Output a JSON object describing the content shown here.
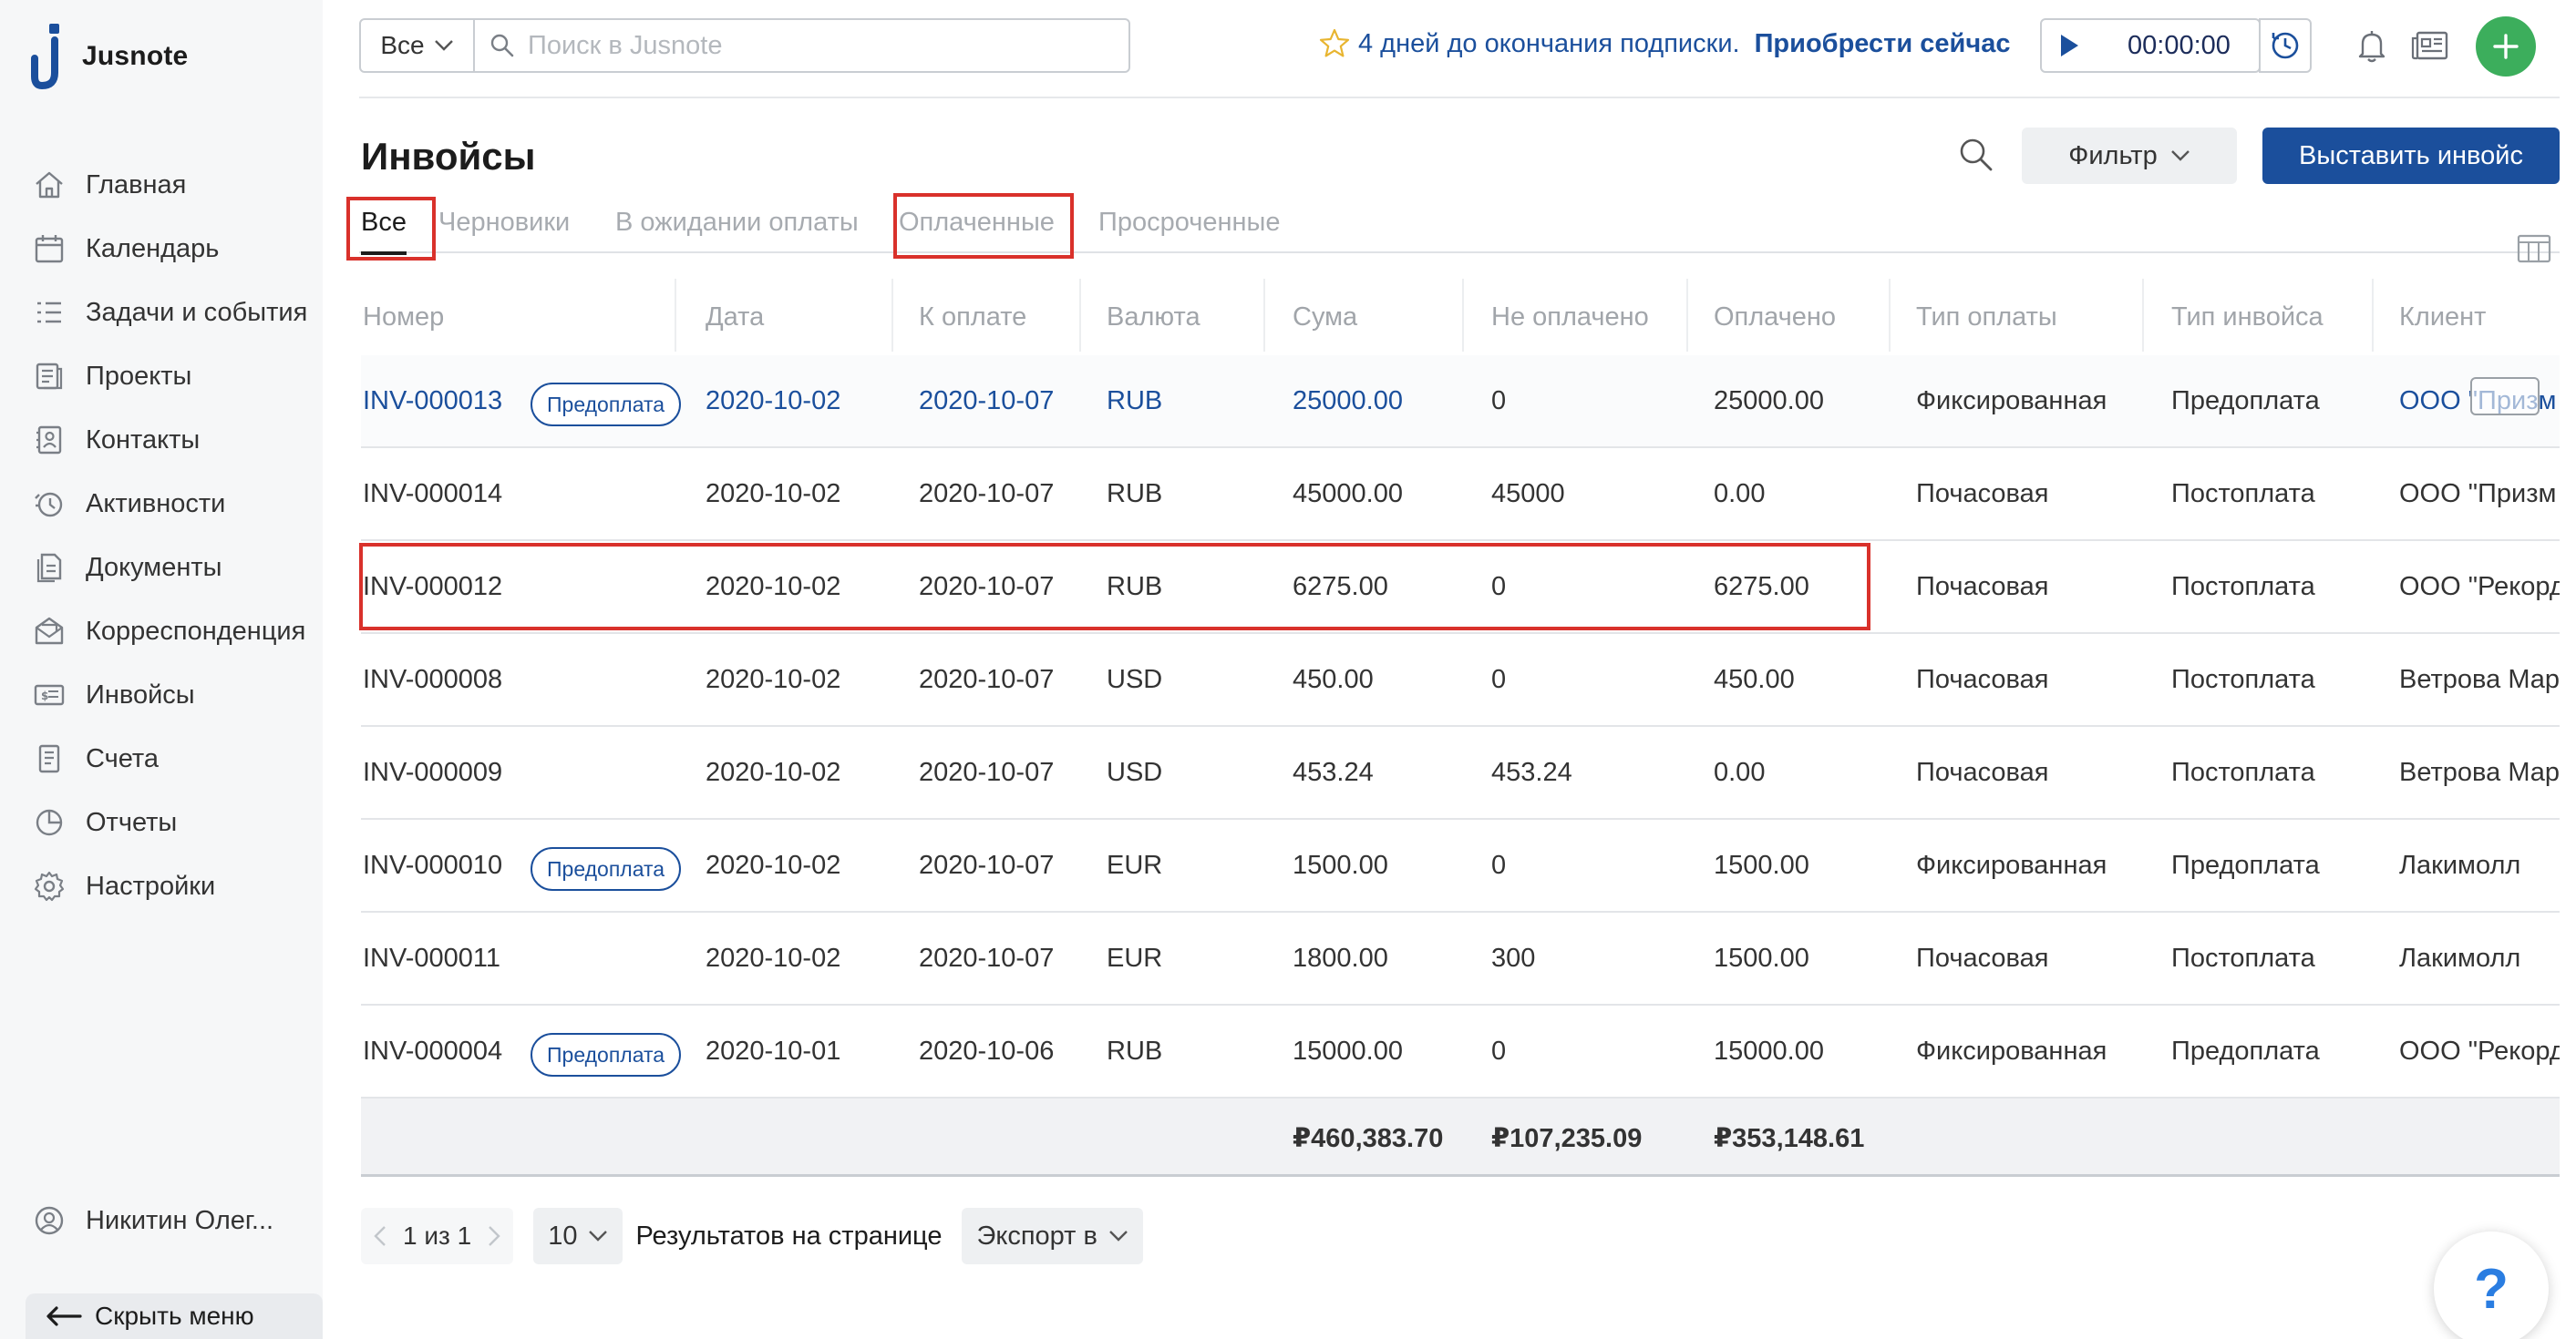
{
  "app": {
    "name": "Jusnote"
  },
  "sidebar": {
    "items": [
      {
        "label": "Главная",
        "icon": "home-icon"
      },
      {
        "label": "Календарь",
        "icon": "calendar-icon"
      },
      {
        "label": "Задачи и события",
        "icon": "tasks-icon"
      },
      {
        "label": "Проекты",
        "icon": "projects-icon"
      },
      {
        "label": "Контакты",
        "icon": "contacts-icon"
      },
      {
        "label": "Активности",
        "icon": "activity-icon"
      },
      {
        "label": "Документы",
        "icon": "documents-icon"
      },
      {
        "label": "Корреспонденция",
        "icon": "correspondence-icon"
      },
      {
        "label": "Инвойсы",
        "icon": "invoices-icon"
      },
      {
        "label": "Счета",
        "icon": "bills-icon"
      },
      {
        "label": "Отчеты",
        "icon": "reports-icon"
      },
      {
        "label": "Настройки",
        "icon": "settings-icon"
      }
    ],
    "user_name": "Никитин Олег...",
    "hide_menu_label": "Скрыть меню"
  },
  "topbar": {
    "scope_value": "Все",
    "search_placeholder": "Поиск в Jusnote",
    "subscription_text": "4 дней до окончания подписки.",
    "subscription_buy": "Приобрести сейчас",
    "timer_value": "00:00:00"
  },
  "page": {
    "title": "Инвойсы",
    "filter_label": "Фильтр",
    "issue_button": "Выставить инвойс"
  },
  "tabs": [
    {
      "label": "Все",
      "active": true
    },
    {
      "label": "Черновики",
      "active": false
    },
    {
      "label": "В ожидании оплаты",
      "active": false
    },
    {
      "label": "Оплаченные",
      "active": false
    },
    {
      "label": "Просроченные",
      "active": false
    }
  ],
  "table": {
    "columns": [
      "Номер",
      "Дата",
      "К оплате",
      "Валюта",
      "Сума",
      "Не оплачено",
      "Оплачено",
      "Тип оплаты",
      "Тип инвойса",
      "Клиент"
    ],
    "rows": [
      {
        "number": "INV-000013",
        "badge": "Предоплата",
        "date": "2020-10-02",
        "due": "2020-10-07",
        "currency": "RUB",
        "amount": "25000.00",
        "unpaid": "0",
        "paid": "25000.00",
        "pay_type": "Фиксированная",
        "invoice_type": "Предоплата",
        "client": "ООО \"Призм"
      },
      {
        "number": "INV-000014",
        "badge": "",
        "date": "2020-10-02",
        "due": "2020-10-07",
        "currency": "RUB",
        "amount": "45000.00",
        "unpaid": "45000",
        "paid": "0.00",
        "pay_type": "Почасовая",
        "invoice_type": "Постоплата",
        "client": "ООО \"Призм"
      },
      {
        "number": "INV-000012",
        "badge": "",
        "date": "2020-10-02",
        "due": "2020-10-07",
        "currency": "RUB",
        "amount": "6275.00",
        "unpaid": "0",
        "paid": "6275.00",
        "pay_type": "Почасовая",
        "invoice_type": "Постоплата",
        "client": "ООО \"Рекорд"
      },
      {
        "number": "INV-000008",
        "badge": "",
        "date": "2020-10-02",
        "due": "2020-10-07",
        "currency": "USD",
        "amount": "450.00",
        "unpaid": "0",
        "paid": "450.00",
        "pay_type": "Почасовая",
        "invoice_type": "Постоплата",
        "client": "Ветрова Мар"
      },
      {
        "number": "INV-000009",
        "badge": "",
        "date": "2020-10-02",
        "due": "2020-10-07",
        "currency": "USD",
        "amount": "453.24",
        "unpaid": "453.24",
        "paid": "0.00",
        "pay_type": "Почасовая",
        "invoice_type": "Постоплата",
        "client": "Ветрова Мар"
      },
      {
        "number": "INV-000010",
        "badge": "Предоплата",
        "date": "2020-10-02",
        "due": "2020-10-07",
        "currency": "EUR",
        "amount": "1500.00",
        "unpaid": "0",
        "paid": "1500.00",
        "pay_type": "Фиксированная",
        "invoice_type": "Предоплата",
        "client": "Лакимолл"
      },
      {
        "number": "INV-000011",
        "badge": "",
        "date": "2020-10-02",
        "due": "2020-10-07",
        "currency": "EUR",
        "amount": "1800.00",
        "unpaid": "300",
        "paid": "1500.00",
        "pay_type": "Почасовая",
        "invoice_type": "Постоплата",
        "client": "Лакимолл"
      },
      {
        "number": "INV-000004",
        "badge": "Предоплата",
        "date": "2020-10-01",
        "due": "2020-10-06",
        "currency": "RUB",
        "amount": "15000.00",
        "unpaid": "0",
        "paid": "15000.00",
        "pay_type": "Фиксированная",
        "invoice_type": "Предоплата",
        "client": "ООО \"Рекорд"
      }
    ],
    "totals": {
      "amount": "₽460,383.70",
      "unpaid": "₽107,235.09",
      "paid": "₽353,148.61"
    }
  },
  "pagination": {
    "page_info": "1 из 1",
    "per_page": "10",
    "per_page_label": "Результатов на странице",
    "export_label": "Экспорт в"
  },
  "help": {
    "label": "?"
  },
  "colors": {
    "accent": "#1b4f9c",
    "add_button": "#3cae5c",
    "highlight_box": "#d9312b"
  }
}
